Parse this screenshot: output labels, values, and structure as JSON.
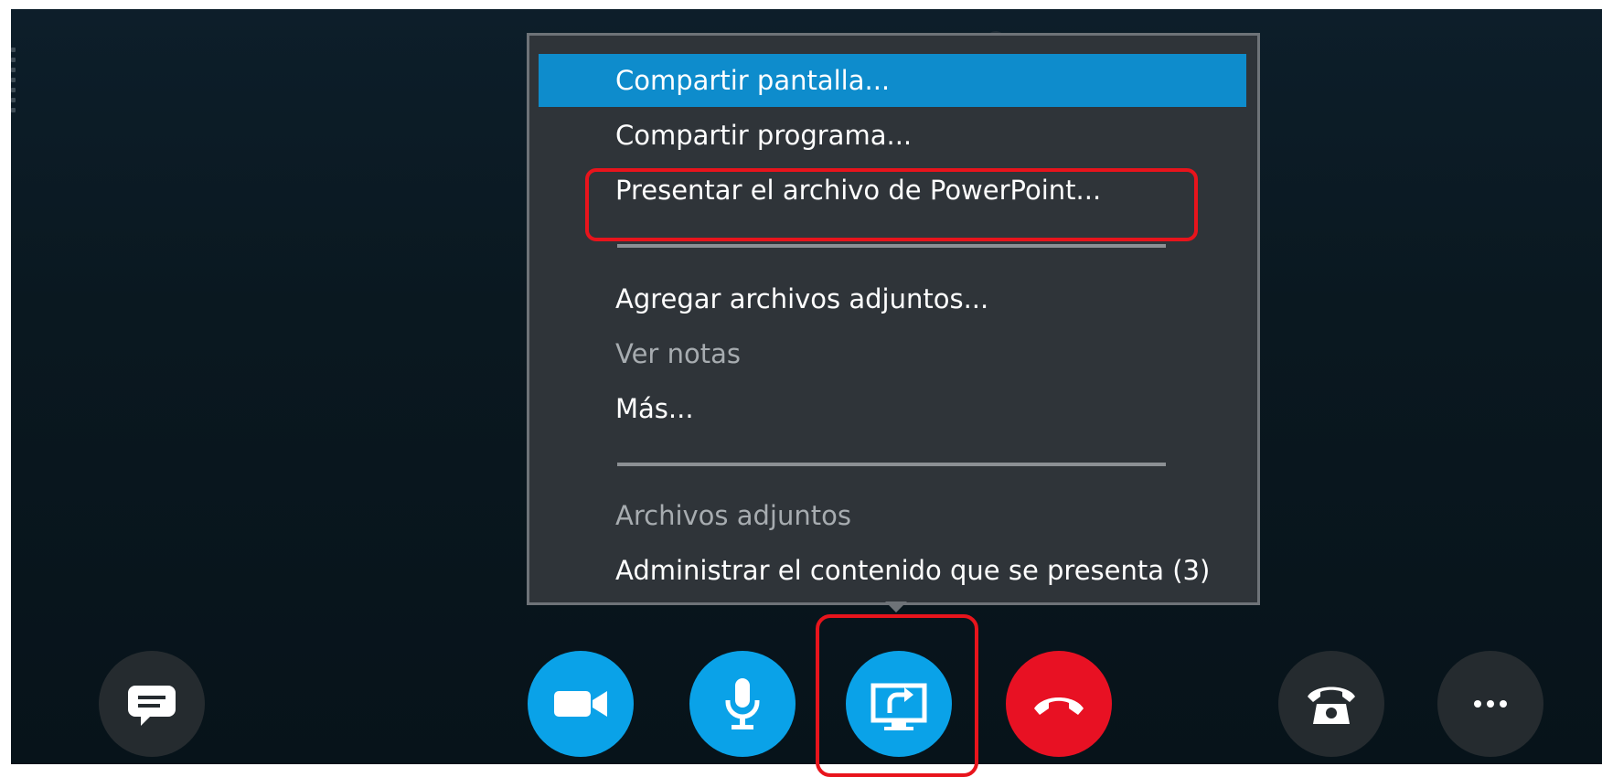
{
  "share_menu": {
    "items": [
      {
        "label": "Compartir pantalla...",
        "state": "selected"
      },
      {
        "label": "Compartir programa...",
        "state": "normal"
      },
      {
        "label": "Presentar el archivo de PowerPoint...",
        "state": "normal",
        "highlighted": true
      },
      {
        "label": "Agregar archivos adjuntos...",
        "state": "normal"
      },
      {
        "label": "Ver notas",
        "state": "disabled"
      },
      {
        "label": "Más...",
        "state": "normal"
      },
      {
        "label": "Archivos adjuntos",
        "state": "disabled"
      },
      {
        "label": "Administrar el contenido que se presenta (3)",
        "state": "normal"
      }
    ]
  },
  "toolbar": {
    "buttons": [
      {
        "icon": "chat-bubble-icon",
        "style": "dark"
      },
      {
        "icon": "video-camera-icon",
        "style": "blue"
      },
      {
        "icon": "microphone-icon",
        "style": "blue"
      },
      {
        "icon": "present-content-icon",
        "style": "blue",
        "highlighted": true
      },
      {
        "icon": "hang-up-icon",
        "style": "red"
      },
      {
        "icon": "dial-pad-phone-icon",
        "style": "dark"
      },
      {
        "icon": "more-options-icon",
        "style": "dark"
      }
    ]
  },
  "colors": {
    "selected_item": "#0e8ccc",
    "call_button_blue": "#0aa2e8",
    "hang_up_red": "#e81123",
    "highlight_outline": "#e8141c"
  }
}
